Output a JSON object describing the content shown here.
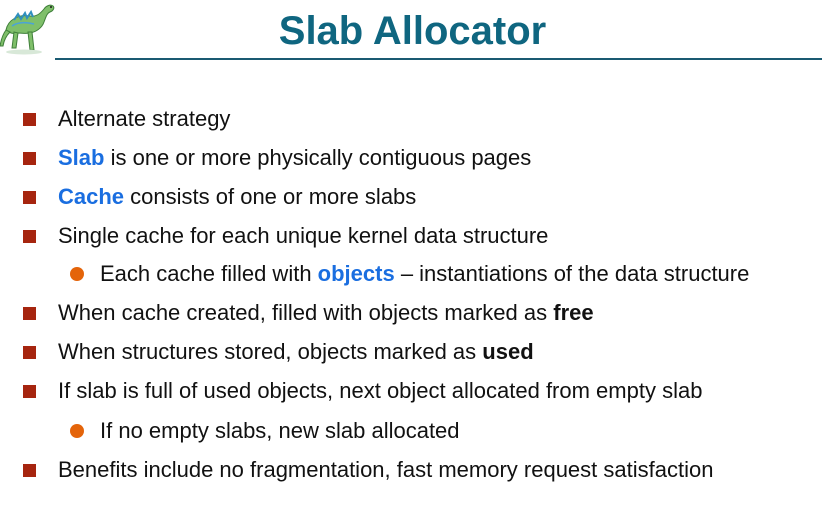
{
  "slide": {
    "title": "Slab Allocator",
    "logo_icon": "dinosaur-logo-icon"
  },
  "bullets": {
    "b1": {
      "text": "Alternate strategy"
    },
    "b2": {
      "keyword": "Slab",
      "rest": " is one or more physically contiguous pages"
    },
    "b3": {
      "keyword": "Cache",
      "rest": " consists of one or more slabs"
    },
    "b4": {
      "text": "Single cache for each unique kernel data structure"
    },
    "b4a": {
      "pre": "Each cache filled with ",
      "keyword": "objects",
      "rest": " – instantiations of the data structure"
    },
    "b5": {
      "pre": "When cache created, filled with objects marked as ",
      "keyword": "free"
    },
    "b6": {
      "pre": "When structures stored, objects marked as ",
      "keyword": "used"
    },
    "b7": {
      "text": "If slab is full of used objects, next object allocated from empty slab"
    },
    "b7a": {
      "text": "If no empty slabs, new slab allocated"
    },
    "b8": {
      "text": "Benefits include no fragmentation, fast memory request satisfaction"
    }
  },
  "colors": {
    "title": "#0f6680",
    "square_bullet": "#a6250f",
    "round_bullet": "#e4640a",
    "keyword_blue": "#1a6ee0"
  }
}
